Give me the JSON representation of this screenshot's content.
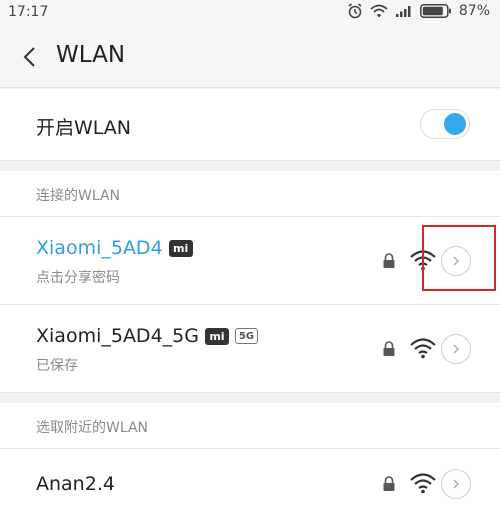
{
  "status_bar": {
    "time": "17:17",
    "battery_percent": "87%",
    "battery_level": 0.87,
    "icons": [
      "alarm-icon",
      "wifi-icon",
      "cell-signal-icon",
      "battery-icon"
    ]
  },
  "header": {
    "back_icon": "chevron-left-icon",
    "title": "WLAN"
  },
  "wlan_toggle": {
    "label": "开启WLAN",
    "enabled": true,
    "accent_color": "#36a9ec"
  },
  "connected_section": {
    "title": "连接的WLAN",
    "networks": [
      {
        "name": "Xiaomi_5AD4",
        "badges": [
          "mi"
        ],
        "status": "点击分享密码",
        "active": true,
        "locked": true
      },
      {
        "name": "Xiaomi_5AD4_5G",
        "badges": [
          "mi",
          "5G"
        ],
        "status": "已保存",
        "active": false,
        "locked": true
      }
    ]
  },
  "nearby_section": {
    "title": "选取附近的WLAN",
    "networks": [
      {
        "name": "Anan2.4",
        "locked": true
      }
    ]
  },
  "badges": {
    "mi": "mi",
    "five_g": "5G"
  },
  "colors": {
    "active_network": "#2f9ee6",
    "highlight": "#d9262c"
  }
}
